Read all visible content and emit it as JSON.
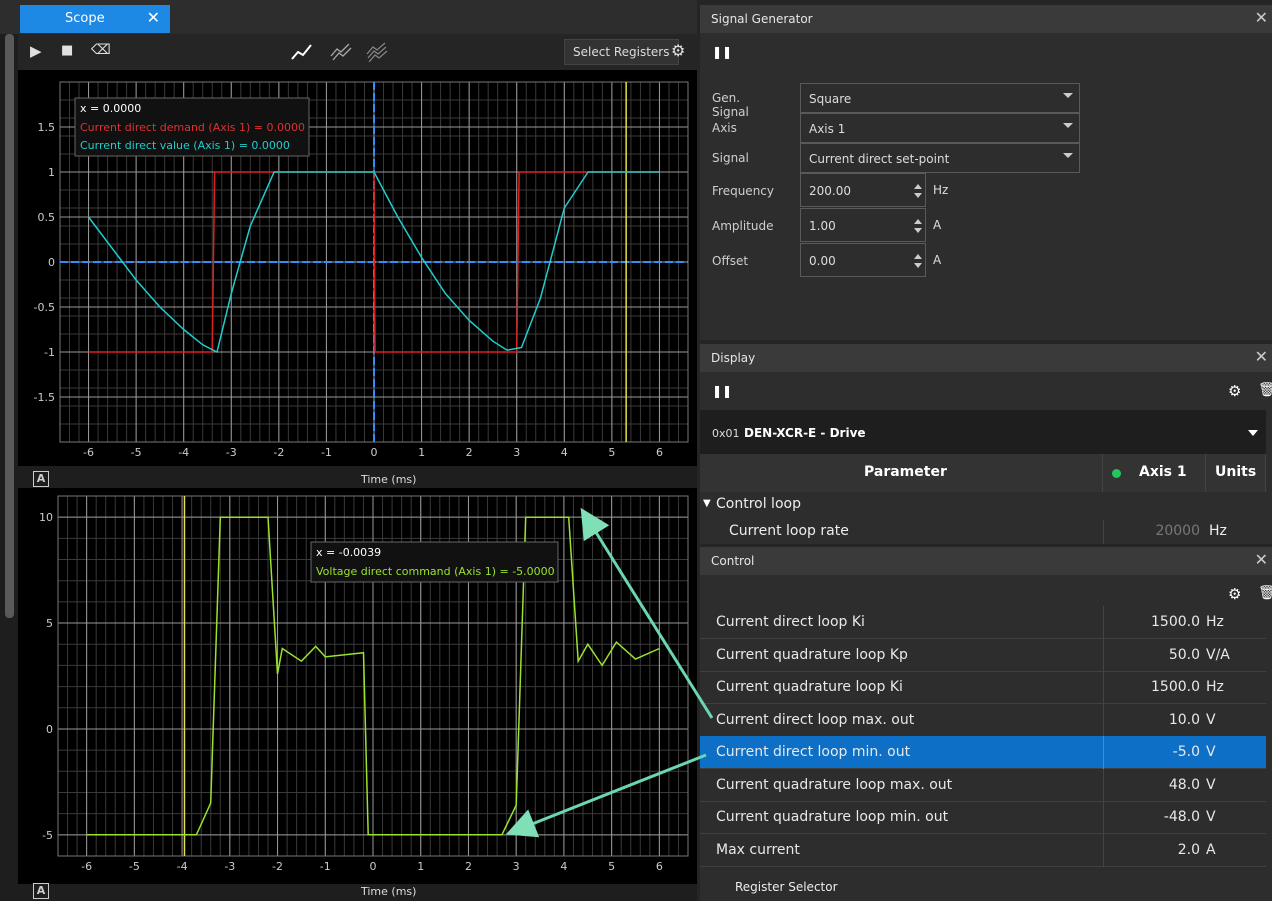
{
  "scope": {
    "tab_title": "Scope",
    "select_registers": "Select Registers",
    "icons": [
      "play-icon",
      "stop-icon",
      "eraser-icon",
      "line-mode-icon",
      "line-mode-2-icon",
      "line-mode-3-icon",
      "gear-icon"
    ]
  },
  "chart_top": {
    "xticks": [
      "-6",
      "-5",
      "-4",
      "-3",
      "-2",
      "-1",
      "0",
      "1",
      "2",
      "3",
      "4",
      "5",
      "6"
    ],
    "yticks": [
      "1.5",
      "1",
      "0.5",
      "0",
      "-0.5",
      "-1",
      "-1.5"
    ],
    "xlabel": "Time (ms)",
    "tooltip": {
      "x": "x = 0.0000",
      "demand": "Current direct demand (Axis 1) = 0.0000",
      "value": "Current direct value (Axis 1) = 0.0000"
    }
  },
  "chart_bottom": {
    "xticks": [
      "-6",
      "-5",
      "-4",
      "-3",
      "-2",
      "-1",
      "0",
      "1",
      "2",
      "3",
      "4",
      "5",
      "6"
    ],
    "yticks": [
      "10",
      "5",
      "0",
      "-5"
    ],
    "xlabel": "Time (ms)",
    "tooltip": {
      "x": "x = -0.0039",
      "voltage": "Voltage direct command (Axis 1) = -5.0000"
    }
  },
  "chart_data": [
    {
      "type": "line",
      "xlabel": "Time (ms)",
      "xlim": [
        -6.6,
        6.6
      ],
      "ylim": [
        -2,
        2
      ],
      "series": [
        {
          "name": "Current direct demand (Axis 1)",
          "color": "#e02020",
          "x": [
            -6,
            -3.4,
            -3.35,
            -1.95,
            0,
            0.02,
            3.0,
            3.05,
            6
          ],
          "y": [
            -1,
            -1,
            1,
            1,
            1,
            -1,
            -1,
            1,
            1
          ]
        },
        {
          "name": "Current direct value (Axis 1)",
          "color": "#22cccc",
          "x": [
            -6,
            -5,
            -4.5,
            -4,
            -3.6,
            -3.3,
            -3,
            -2.6,
            -2.1,
            -2,
            -1,
            0,
            0.5,
            1,
            1.5,
            2,
            2.5,
            2.8,
            3.1,
            3.5,
            4,
            4.5,
            5,
            6
          ],
          "y": [
            0.5,
            -0.2,
            -0.5,
            -0.75,
            -0.92,
            -1.0,
            -0.35,
            0.4,
            1.0,
            1.0,
            1.0,
            1.0,
            0.5,
            0.05,
            -0.35,
            -0.65,
            -0.88,
            -0.98,
            -0.95,
            -0.4,
            0.6,
            1.0,
            1.0,
            1.0
          ]
        }
      ]
    },
    {
      "type": "line",
      "xlabel": "Time (ms)",
      "xlim": [
        -6.6,
        6.6
      ],
      "ylim": [
        -6,
        11
      ],
      "series": [
        {
          "name": "Voltage direct command (Axis 1)",
          "color": "#9be22d",
          "x": [
            -6,
            -3.7,
            -3.4,
            -3.2,
            -2.8,
            -2.2,
            -2.0,
            -1.9,
            -1.5,
            -1.2,
            -1.0,
            -0.2,
            -0.1,
            0,
            2.7,
            3.0,
            3.2,
            4.1,
            4.3,
            4.5,
            4.8,
            5.1,
            5.5,
            6
          ],
          "y": [
            -5,
            -5,
            -3.5,
            10,
            10,
            10,
            2.6,
            3.8,
            3.2,
            3.9,
            3.4,
            3.6,
            -5,
            -5,
            -5,
            -3.6,
            10,
            10,
            3.2,
            4.0,
            3.0,
            4.1,
            3.3,
            3.8
          ]
        }
      ]
    }
  ],
  "signal_generator": {
    "title": "Signal Generator",
    "gen_signal_label": "Gen. Signal",
    "gen_signal_value": "Square",
    "axis_label": "Axis",
    "axis_value": "Axis 1",
    "signal_label": "Signal",
    "signal_value": "Current direct set-point",
    "frequency_label": "Frequency",
    "frequency_value": "200.00",
    "frequency_unit": "Hz",
    "amplitude_label": "Amplitude",
    "amplitude_value": "1.00",
    "amplitude_unit": "A",
    "offset_label": "Offset",
    "offset_value": "0.00",
    "offset_unit": "A"
  },
  "display": {
    "title": "Display",
    "drive_addr": "0x01",
    "drive_name": "DEN-XCR-E - Drive",
    "col_parameter": "Parameter",
    "col_axis": "Axis 1",
    "col_units": "Units",
    "group": "Control loop",
    "row_name": "Current loop rate",
    "row_value": "20000",
    "row_unit": "Hz"
  },
  "control": {
    "title": "Control",
    "rows": [
      {
        "name": "Current direct loop Ki",
        "value": "1500.0",
        "unit": "Hz"
      },
      {
        "name": "Current quadrature loop Kp",
        "value": "50.0",
        "unit": "V/A"
      },
      {
        "name": "Current quadrature loop Ki",
        "value": "1500.0",
        "unit": "Hz"
      },
      {
        "name": "Current direct loop max. out",
        "value": "10.0",
        "unit": "V"
      },
      {
        "name": "Current direct loop min. out",
        "value": "-5.0",
        "unit": "V"
      },
      {
        "name": "Current quadrature loop max. out",
        "value": "48.0",
        "unit": "V"
      },
      {
        "name": "Current quadrature loop min. out",
        "value": "-48.0",
        "unit": "V"
      },
      {
        "name": "Max current",
        "value": "2.0",
        "unit": "A"
      }
    ],
    "selected_index": 4,
    "footer": "Register Selector"
  }
}
